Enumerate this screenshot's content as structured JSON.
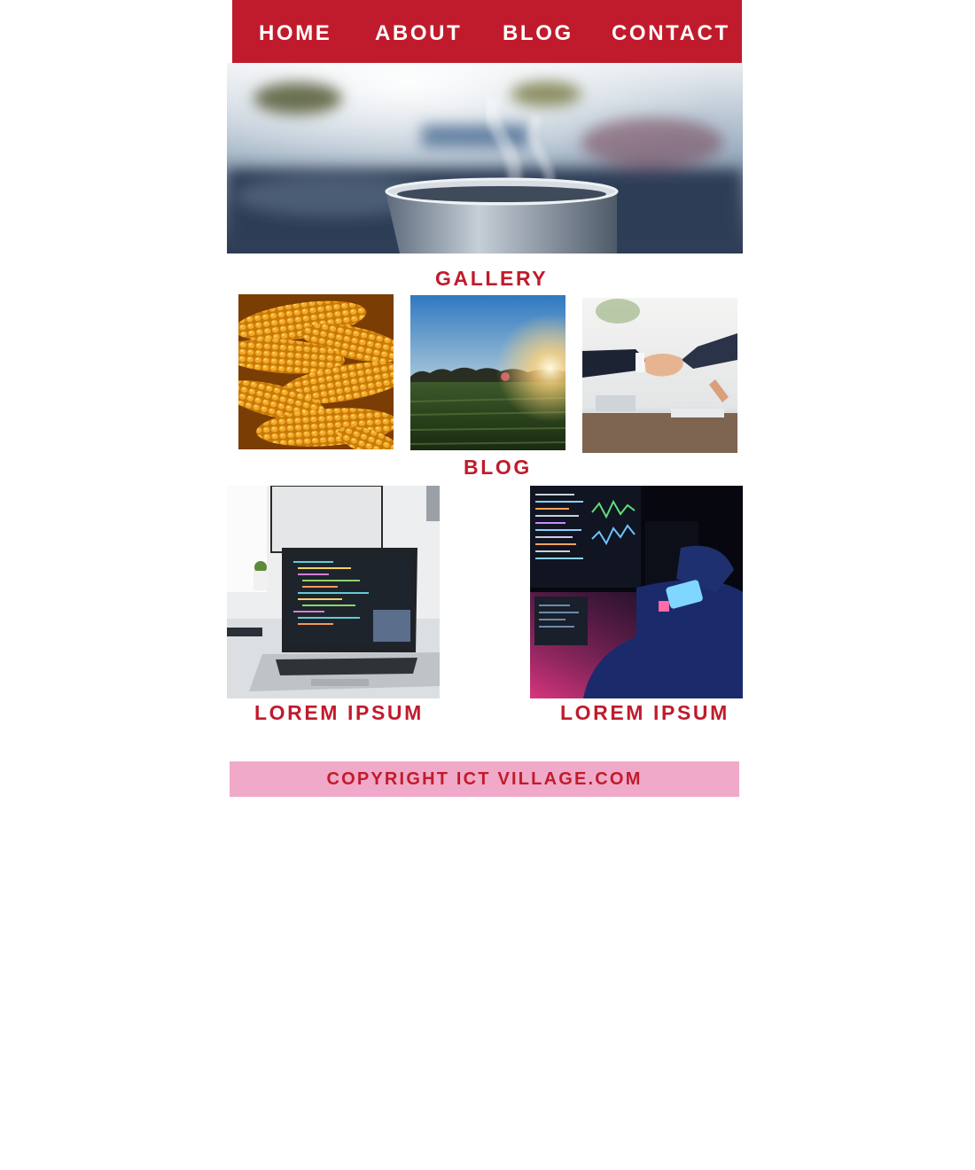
{
  "nav": {
    "items": [
      {
        "label": "HOME"
      },
      {
        "label": "ABOUT"
      },
      {
        "label": "BLOG"
      },
      {
        "label": "CONTACT"
      }
    ]
  },
  "gallery": {
    "title": "GALLERY"
  },
  "blog": {
    "title": "BLOG",
    "posts": [
      {
        "caption": "LOREM IPSUM"
      },
      {
        "caption": "LOREM IPSUM"
      }
    ]
  },
  "footer": {
    "text": "COPYRIGHT ICT VILLAGE.COM"
  },
  "colors": {
    "brand_red": "#c01b2c",
    "footer_pink": "#f0a9c8",
    "nav_text": "#ffffff"
  },
  "icons": {
    "hero": "steaming-mug-photo",
    "gallery": [
      "corn-cobs-photo",
      "sunset-field-photo",
      "handshake-photo"
    ],
    "blog": [
      "laptop-code-photo",
      "hacker-night-photo"
    ]
  }
}
